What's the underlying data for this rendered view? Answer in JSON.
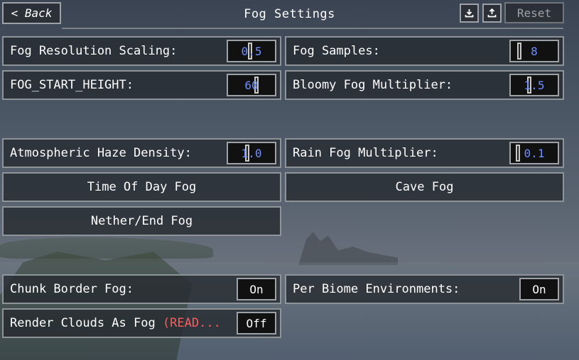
{
  "header": {
    "title": "Fog Settings",
    "back_label": "< Back",
    "reset_label": "Reset",
    "import_icon": "download-icon",
    "export_icon": "upload-icon"
  },
  "options": {
    "fog_resolution_scaling": {
      "label": "Fog Resolution Scaling:",
      "value": "0.5"
    },
    "fog_samples": {
      "label": "Fog Samples:",
      "value": "8"
    },
    "fog_start_height": {
      "label": "FOG_START_HEIGHT:",
      "value": "60"
    },
    "bloomy_fog_multiplier": {
      "label": "Bloomy Fog Multiplier:",
      "value": "1.5"
    },
    "atmospheric_haze_density": {
      "label": "Atmospheric Haze Density:",
      "value": "1.0"
    },
    "rain_fog_multiplier": {
      "label": "Rain Fog Multiplier:",
      "value": "0.1"
    },
    "time_of_day_fog": {
      "label": "Time Of Day Fog"
    },
    "cave_fog": {
      "label": "Cave Fog"
    },
    "nether_end_fog": {
      "label": "Nether/End Fog"
    },
    "chunk_border_fog": {
      "label": "Chunk Border Fog:",
      "value": "On"
    },
    "per_biome_environments": {
      "label": "Per Biome Environments:",
      "value": "On"
    },
    "render_clouds_as_fog": {
      "label": "Render Clouds As Fog ",
      "label_warning": "(READ...",
      "value": "Off"
    }
  },
  "colors": {
    "value_blue": "#6f8fff",
    "warning_red": "#ff5a5a"
  }
}
